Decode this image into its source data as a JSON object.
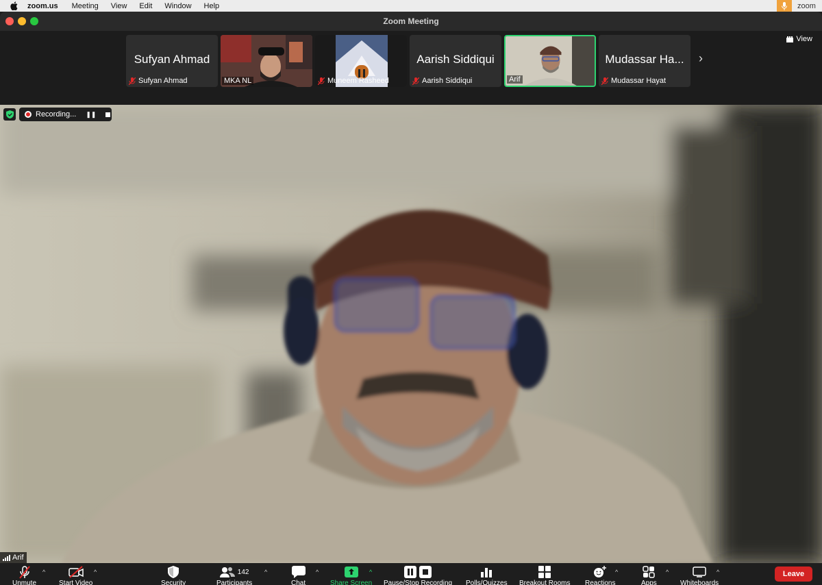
{
  "menubar": {
    "app": "zoom.us",
    "items": [
      "Meeting",
      "View",
      "Edit",
      "Window",
      "Help"
    ],
    "brand": "zoom"
  },
  "window": {
    "title": "Zoom Meeting"
  },
  "strip": {
    "view_label": "View",
    "tiles": [
      {
        "big_name": "Sufyan Ahmad",
        "label": "Sufyan Ahmad",
        "muted": true
      },
      {
        "big_name": "",
        "label": "MKA NL",
        "muted": false
      },
      {
        "big_name": "",
        "label": "Muneem Rasheed",
        "muted": true
      },
      {
        "big_name": "Aarish Siddiqui",
        "label": "Aarish Siddiqui",
        "muted": true
      },
      {
        "big_name": "",
        "label": "Arif",
        "muted": false,
        "active": true
      },
      {
        "big_name": "Mudassar Ha...",
        "label": "Mudassar Hayat",
        "muted": true
      }
    ]
  },
  "main": {
    "recording_label": "Recording...",
    "speaker_name": "Arif"
  },
  "toolbar": {
    "unmute": "Unmute",
    "start_video": "Start Video",
    "security": "Security",
    "participants": "Participants",
    "participants_count": "142",
    "chat": "Chat",
    "share_screen": "Share Screen",
    "pause_stop": "Pause/Stop Recording",
    "polls": "Polls/Quizzes",
    "breakout": "Breakout Rooms",
    "reactions": "Reactions",
    "apps": "Apps",
    "whiteboards": "Whiteboards",
    "leave": "Leave"
  },
  "colors": {
    "active_border": "#2dd36f",
    "leave": "#d32323",
    "share_green": "#2dd36f",
    "muted_red": "#e02828"
  }
}
